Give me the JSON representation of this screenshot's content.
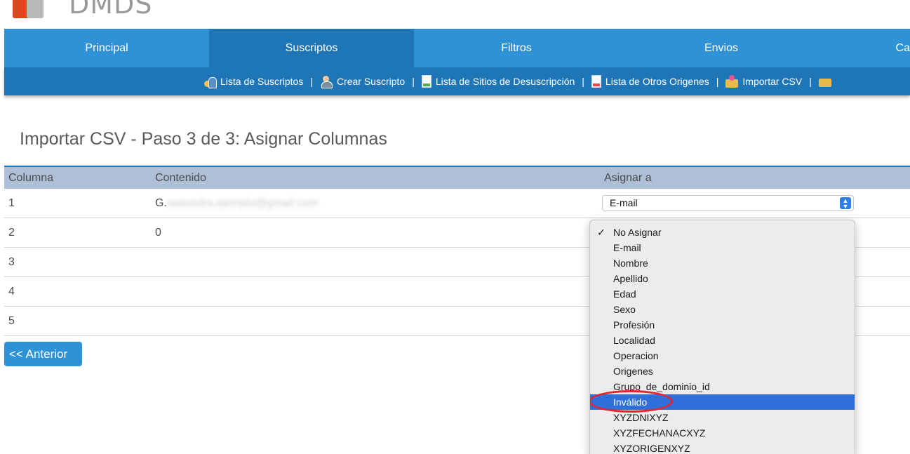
{
  "logo": {
    "text": "DMDS"
  },
  "main_nav": {
    "tabs": [
      {
        "label": "Principal",
        "active": false
      },
      {
        "label": "Suscriptos",
        "active": true
      },
      {
        "label": "Filtros",
        "active": false
      },
      {
        "label": "Envios",
        "active": false
      },
      {
        "label": "Ca",
        "active": false
      }
    ]
  },
  "sub_nav": {
    "items": [
      {
        "label": "Lista de Suscriptos",
        "icon": "users-icon"
      },
      {
        "label": "Crear Suscripto",
        "icon": "add-user-icon"
      },
      {
        "label": "Lista de Sitios de Desuscripción",
        "icon": "green-document-icon"
      },
      {
        "label": "Lista de Otros Origenes",
        "icon": "red-document-icon"
      },
      {
        "label": "Importar CSV",
        "icon": "import-icon"
      }
    ],
    "separator": "|"
  },
  "page": {
    "title": "Importar CSV - Paso 3 de 3: Asignar Columnas"
  },
  "table": {
    "headers": {
      "column": "Columna",
      "content": "Contenido",
      "assign": "Asignar a"
    },
    "rows": [
      {
        "column": "1",
        "content": "G.",
        "content_blurred": "saavedra.ejemplo@gmail.com"
      },
      {
        "column": "2",
        "content": "0"
      },
      {
        "column": "3",
        "content": ""
      },
      {
        "column": "4",
        "content": ""
      },
      {
        "column": "5",
        "content": ""
      }
    ]
  },
  "select": {
    "value": "E-mail",
    "arrow_glyph": "⌃⌄"
  },
  "dropdown": {
    "check_glyph": "✓",
    "selected_option": "No Asignar",
    "highlighted_option": "Inválido",
    "options": [
      "No Asignar",
      "E-mail",
      "Nombre",
      "Apellido",
      "Edad",
      "Sexo",
      "Profesión",
      "Localidad",
      "Operacion",
      "Origenes",
      "Grupo_de_dominio_id",
      "Inválido",
      "XYZDNIXYZ",
      "XYZFECHANACXYZ",
      "XYZORIGENXYZ"
    ]
  },
  "back_button": {
    "label": "<< Anterior"
  },
  "colors": {
    "nav_bg": "#2f92d7",
    "nav_active": "#1f76b6",
    "table_header_bg": "#aebfd7",
    "highlight": "#2e6fd9",
    "annotation": "#e4242e"
  }
}
